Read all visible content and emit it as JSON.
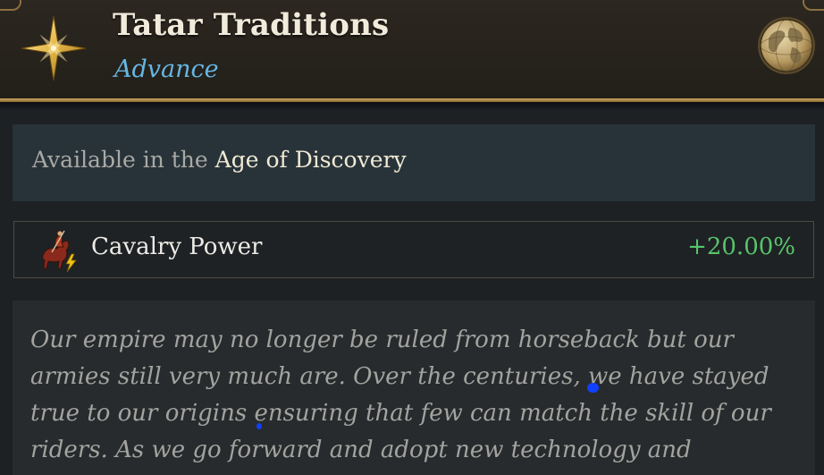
{
  "header": {
    "title": "Tatar Traditions",
    "subtitle": "Advance",
    "icon": "compass-star-icon",
    "corner_icon": "globe-icon"
  },
  "availability": {
    "prefix": "Available in the ",
    "age": "Age of Discovery"
  },
  "modifier": {
    "icon": "cavalry-power-icon",
    "label": "Cavalry Power",
    "value": "+20.00%"
  },
  "description": {
    "text": "Our empire may no longer be ruled from horseback but our armies still very much are. Over the centuries, we have stayed true to our origins ensuring that few can match the skill of our riders. As we go forward and adopt new technology and"
  },
  "colors": {
    "title": "#f1ebdc",
    "subtitle": "#66b6e2",
    "gold_accent": "#c9a55e",
    "positive_value": "#57c46a",
    "age_highlight": "#f1ead4"
  }
}
